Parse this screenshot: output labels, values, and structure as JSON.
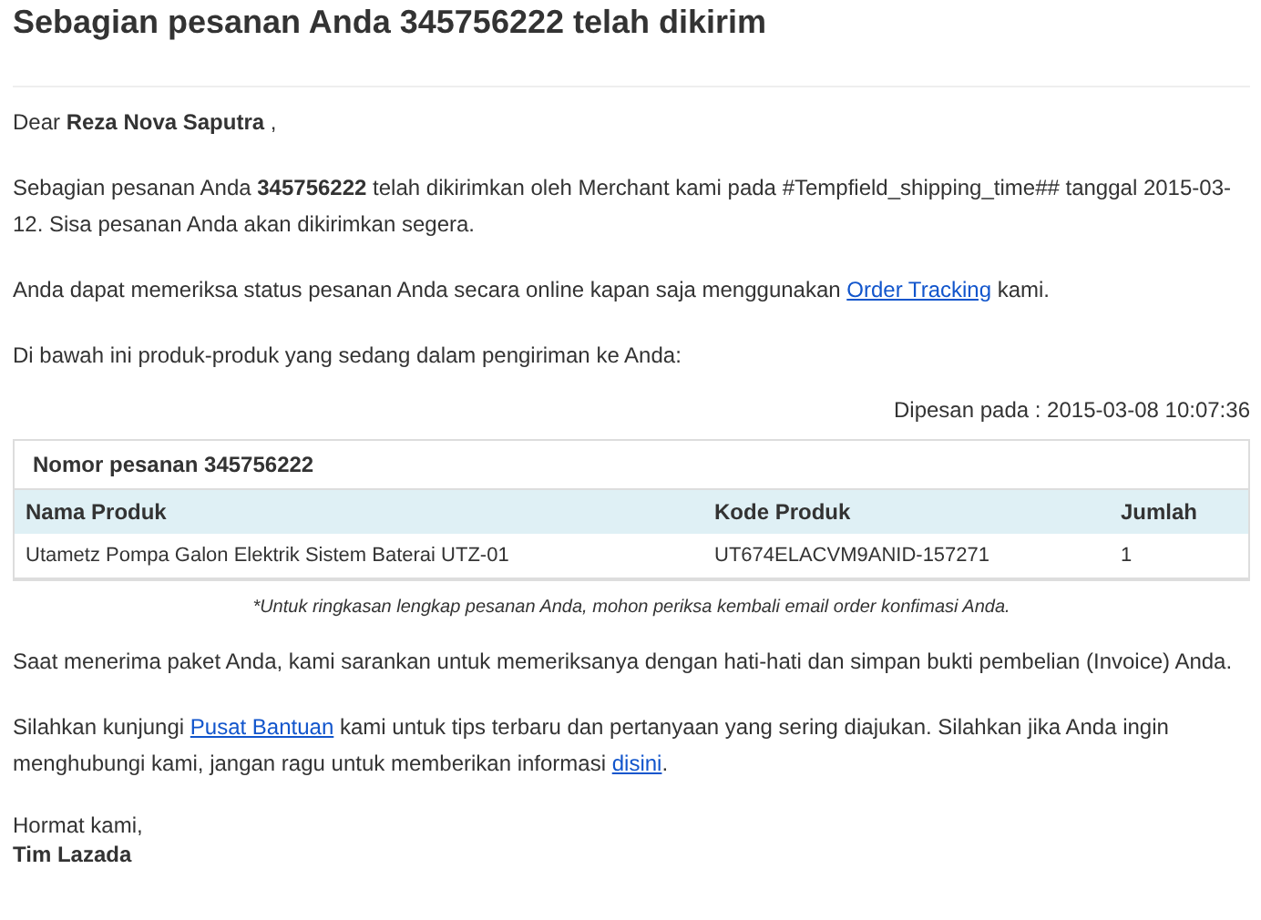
{
  "title": "Sebagian pesanan Anda 345756222 telah dikirim",
  "paragraphs": [
    [
      {
        "kind": "text",
        "text": "Dear **Reza Nova Saputra** ,"
      }
    ],
    [
      {
        "kind": "text",
        "text": "Sebagian pesanan Anda **345756222** telah dikirimkan oleh Merchant kami pada #Tempfield_shipping_time## tanggal 2015-03-12. Sisa pesanan Anda akan dikirimkan segera."
      }
    ],
    [
      {
        "kind": "text",
        "text": "Anda dapat memeriksa status pesanan Anda secara online kapan saja menggunakan "
      },
      {
        "kind": "link",
        "text": "Order Tracking"
      },
      {
        "kind": "text",
        "text": " kami."
      }
    ],
    [
      {
        "kind": "text",
        "text": "Di bawah ini produk-produk yang sedang dalam pengiriman ke Anda:"
      }
    ]
  ],
  "ordered_at": "Dipesan pada : 2015-03-08 10:07:36",
  "order": {
    "heading": "Nomor pesanan 345756222",
    "columns": [
      "Nama Produk",
      "Kode Produk",
      "Jumlah"
    ],
    "rows": [
      [
        "Utametz Pompa Galon Elektrik Sistem Baterai UTZ-01",
        "UT674ELACVM9ANID-157271",
        "1"
      ]
    ]
  },
  "note": "*Untuk ringkasan lengkap pesanan Anda, mohon periksa kembali email order konfimasi Anda.",
  "after": [
    [
      {
        "kind": "text",
        "text": "Saat menerima paket Anda, kami sarankan untuk memeriksanya dengan hati-hati dan simpan bukti pembelian (Invoice) Anda."
      }
    ],
    [
      {
        "kind": "text",
        "text": "Silahkan kunjungi "
      },
      {
        "kind": "link",
        "text": "Pusat Bantuan"
      },
      {
        "kind": "text",
        "text": " kami untuk tips terbaru dan pertanyaan yang sering diajukan. Silahkan jika Anda ingin menghubungi kami, jangan ragu untuk memberikan informasi "
      },
      {
        "kind": "link",
        "text": "disini"
      },
      {
        "kind": "text",
        "text": "."
      }
    ]
  ],
  "closing": "Hormat kami,",
  "signature": "Tim Lazada"
}
